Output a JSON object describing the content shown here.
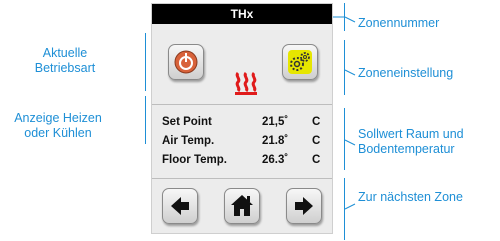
{
  "device": {
    "zone_title": "THx",
    "rows": [
      {
        "label": "Set Point",
        "value": "21,5˚",
        "unit": "C"
      },
      {
        "label": "Air Temp.",
        "value": "21.8˚",
        "unit": "C"
      },
      {
        "label": "Floor Temp.",
        "value": "26.3˚",
        "unit": "C"
      }
    ]
  },
  "callouts": {
    "left_mode": "Aktuelle Betriebsart",
    "left_heat": "Anzeige Heizen oder Kühlen",
    "right_zone_number": "Zonennummer",
    "right_zone_settings": "Zoneneinstellung",
    "right_setpoint": "Sollwert Raum und Bodentemperatur",
    "right_next_zone": "Zur nächsten Zone"
  },
  "colors": {
    "callout": "#1e8fd6",
    "mode_icon": "#d8623a",
    "settings_icon": "#e6e600",
    "heat_icon": "#e01b1b"
  }
}
